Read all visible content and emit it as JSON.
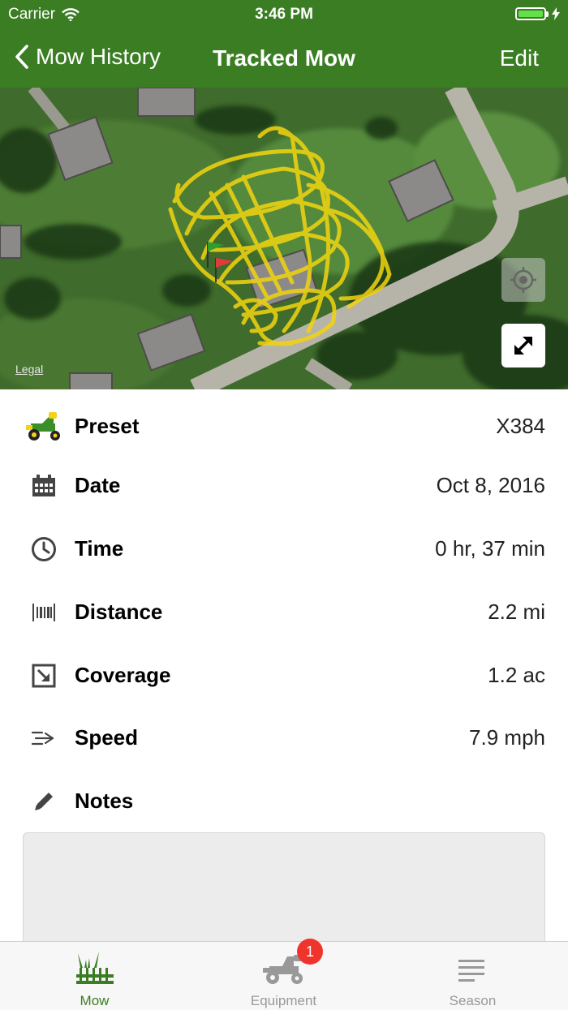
{
  "status_bar": {
    "carrier": "Carrier",
    "time": "3:46 PM"
  },
  "nav": {
    "back_label": "Mow History",
    "title": "Tracked Mow",
    "edit_label": "Edit"
  },
  "map": {
    "legal_label": "Legal"
  },
  "details": [
    {
      "key": "preset",
      "icon": "mower-icon",
      "label": "Preset",
      "value": "X384"
    },
    {
      "key": "date",
      "icon": "calendar-icon",
      "label": "Date",
      "value": "Oct 8, 2016"
    },
    {
      "key": "time",
      "icon": "clock-icon",
      "label": "Time",
      "value": "0 hr, 37 min"
    },
    {
      "key": "distance",
      "icon": "distance-icon",
      "label": "Distance",
      "value": "2.2 mi"
    },
    {
      "key": "coverage",
      "icon": "coverage-icon",
      "label": "Coverage",
      "value": "1.2 ac"
    },
    {
      "key": "speed",
      "icon": "speed-icon",
      "label": "Speed",
      "value": "7.9 mph"
    },
    {
      "key": "notes",
      "icon": "pencil-icon",
      "label": "Notes",
      "value": ""
    }
  ],
  "tabs": [
    {
      "label": "Mow",
      "icon": "grass-icon",
      "active": true
    },
    {
      "label": "Equipment",
      "icon": "tractor-icon",
      "active": false
    },
    {
      "label": "Season",
      "icon": "season-icon",
      "active": false,
      "badge": "1"
    }
  ],
  "colors": {
    "brand_green": "#3a7d23",
    "track_yellow": "#f2d40f",
    "badge_red": "#f0332b"
  }
}
